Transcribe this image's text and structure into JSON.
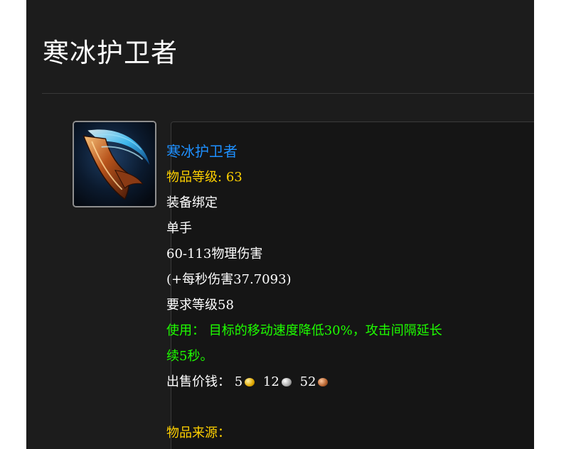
{
  "page": {
    "title": "寒冰护卫者"
  },
  "item_tooltip": {
    "icon": "blue-ice-curved-dagger-icon",
    "name": "寒冰护卫者",
    "item_level_label": "物品等级:",
    "item_level_value": "63",
    "binding": "装备绑定",
    "slot": "单手",
    "damage": "60-113物理伤害",
    "dps": "(+每秒伤害37.7093)",
    "required_level": "要求等级58",
    "use_effect_line1": "使用： 目标的移动速度降低30%，攻击间隔延长",
    "use_effect_line2": "续5秒。",
    "sell_price_label": "出售价钱：",
    "sell_gold": "5",
    "sell_silver": "12",
    "sell_copper": "52",
    "source_label": "物品来源："
  },
  "colors": {
    "item_name_blue": "#1e90ff",
    "gold_text": "#ffd100",
    "green_text": "#1eff00",
    "background": "#1c1c1c"
  }
}
